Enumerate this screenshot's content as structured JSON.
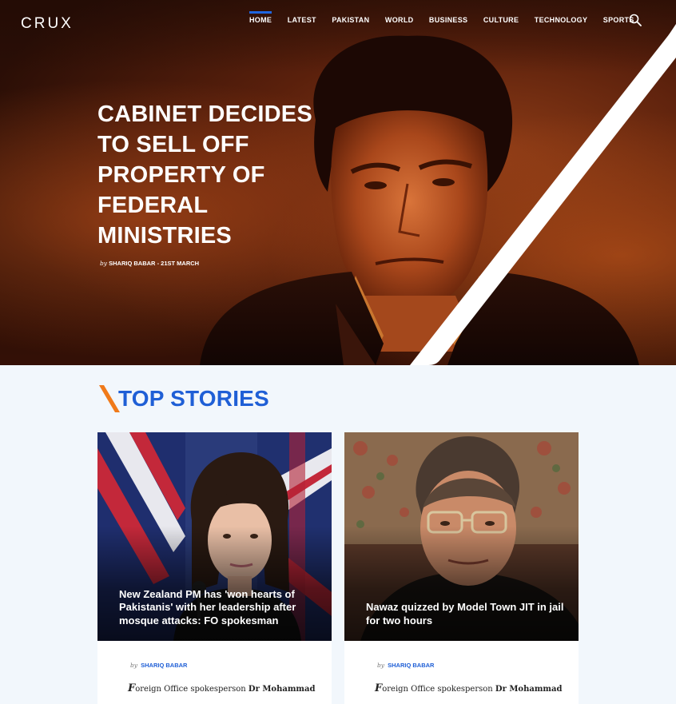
{
  "brand": {
    "logo": "CRUX"
  },
  "nav": {
    "items": [
      {
        "label": "HOME",
        "active": true
      },
      {
        "label": "LATEST"
      },
      {
        "label": "PAKISTAN"
      },
      {
        "label": "WORLD"
      },
      {
        "label": "BUSINESS"
      },
      {
        "label": "CULTURE"
      },
      {
        "label": "TECHNOLOGY"
      },
      {
        "label": "SPORTS"
      }
    ],
    "search_icon": "search-icon"
  },
  "hero": {
    "headline": "CABINET DECIDES TO SELL OFF PROPERTY OF FEDERAL MINISTRIES",
    "by": "by",
    "author": "SHARIQ BABAR",
    "separator": " - ",
    "date": "21ST MARCH"
  },
  "top_stories": {
    "title": "TOP STORIES",
    "cards": [
      {
        "title": "New Zealand PM has 'won hearts of Pakistanis' with her leadership after mosque attacks: FO spokesman",
        "by": "by",
        "author": "SHARIQ BABAR",
        "excerpt_dropcap": "F",
        "excerpt_rest": "oreign Office spokesperson ",
        "excerpt_bold": "Dr Mohammad"
      },
      {
        "title": "Nawaz quizzed by Model Town JIT in jail for two hours",
        "by": "by",
        "author": "SHARIQ BABAR",
        "excerpt_dropcap": "F",
        "excerpt_rest": "oreign Office spokesperson ",
        "excerpt_bold": "Dr Mohammad"
      }
    ]
  },
  "colors": {
    "accent_blue": "#1f5fd6",
    "accent_orange": "#f07a1a",
    "hero_base": "#5a200c"
  }
}
